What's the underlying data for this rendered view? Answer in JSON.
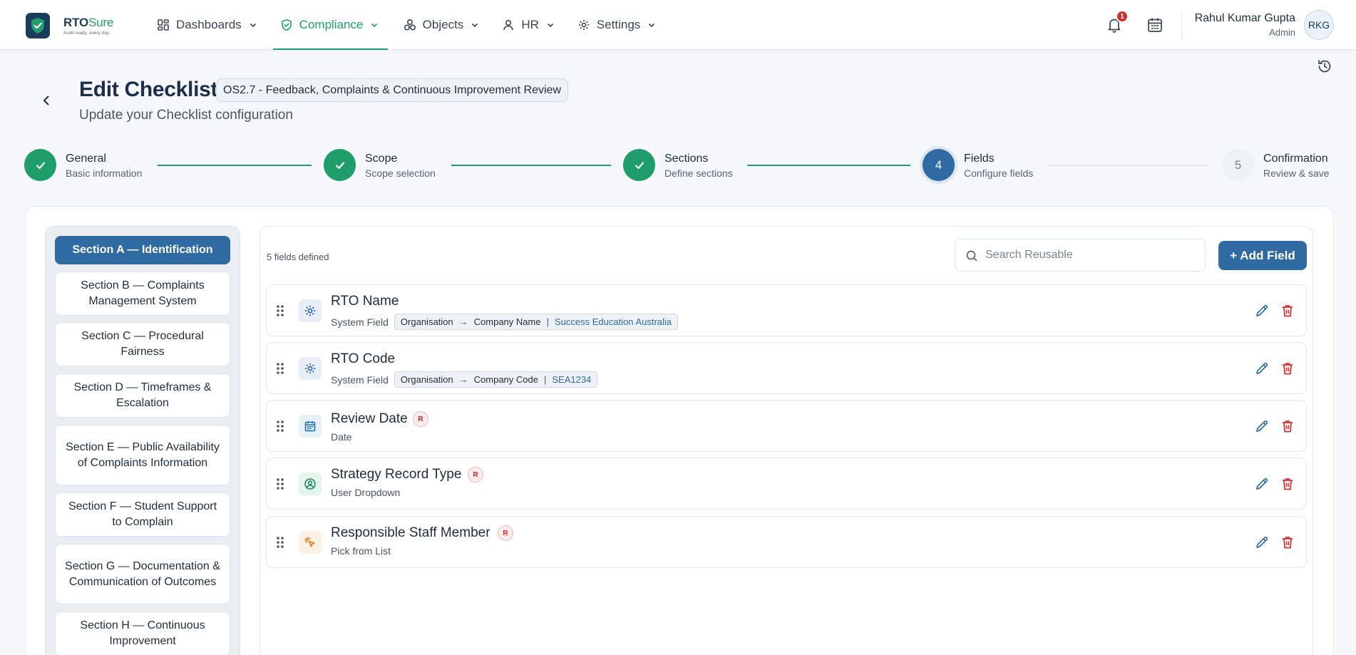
{
  "brand": {
    "name_primary": "RTO",
    "name_accent": "Sure",
    "tagline": "Audit-ready, every day."
  },
  "nav": [
    {
      "label": "Dashboards",
      "icon": "grid-icon",
      "active": false
    },
    {
      "label": "Compliance",
      "icon": "shield-check-icon",
      "active": true
    },
    {
      "label": "Objects",
      "icon": "shapes-icon",
      "active": false
    },
    {
      "label": "HR",
      "icon": "user-icon",
      "active": false
    },
    {
      "label": "Settings",
      "icon": "gear-icon",
      "active": false
    }
  ],
  "notifications": {
    "count": "1"
  },
  "user": {
    "name": "Rahul Kumar Gupta",
    "role": "Admin",
    "initials": "RKG"
  },
  "page": {
    "title": "Edit Checklist",
    "checklist_name": "OS2.7 - Feedback, Complaints & Continuous Improvement Review",
    "subtitle": "Update your Checklist configuration"
  },
  "steps": [
    {
      "title": "General",
      "desc": "Basic information",
      "state": "done",
      "number": "1"
    },
    {
      "title": "Scope",
      "desc": "Scope selection",
      "state": "done",
      "number": "2"
    },
    {
      "title": "Sections",
      "desc": "Define sections",
      "state": "done",
      "number": "3"
    },
    {
      "title": "Fields",
      "desc": "Configure fields",
      "state": "current",
      "number": "4"
    },
    {
      "title": "Confirmation",
      "desc": "Review & save",
      "state": "todo",
      "number": "5"
    }
  ],
  "sections": [
    {
      "label": "Section A — Identification",
      "active": true
    },
    {
      "label": "Section B — Complaints Management System",
      "active": false
    },
    {
      "label": "Section C — Procedural Fairness",
      "active": false
    },
    {
      "label": "Section D — Timeframes & Escalation",
      "active": false
    },
    {
      "label": "Section E — Public Availability of Complaints Information",
      "active": false
    },
    {
      "label": "Section F — Student Support to Complain",
      "active": false
    },
    {
      "label": "Section G — Documentation & Communication of Outcomes",
      "active": false
    },
    {
      "label": "Section H — Continuous Improvement",
      "active": false
    }
  ],
  "fields_panel": {
    "count_text": "5 fields defined",
    "search_placeholder": "Search Reusable",
    "add_button": "+ Add Field"
  },
  "fields": [
    {
      "name": "RTO Name",
      "type": "System Field",
      "icon": "gear-icon",
      "required": false,
      "mapping": {
        "source": "Organisation",
        "target": "Company Name",
        "value": "Success Education Australia"
      }
    },
    {
      "name": "RTO Code",
      "type": "System Field",
      "icon": "gear-icon",
      "required": false,
      "mapping": {
        "source": "Organisation",
        "target": "Company Code",
        "value": "SEA1234"
      }
    },
    {
      "name": "Review Date",
      "type": "Date",
      "icon": "calendar-icon",
      "required": true,
      "required_label": "R"
    },
    {
      "name": "Strategy Record Type",
      "type": "User Dropdown",
      "icon": "user-circle-icon",
      "required": true,
      "required_label": "R"
    },
    {
      "name": "Responsible Staff Member",
      "type": "Pick from List",
      "icon": "pointer-click-icon",
      "required": true,
      "required_label": "R"
    }
  ],
  "colors": {
    "brand": "#1d3b5a",
    "accent_green": "#1f9d6b",
    "primary_blue": "#2f6aa3",
    "danger": "#d32f2f"
  }
}
